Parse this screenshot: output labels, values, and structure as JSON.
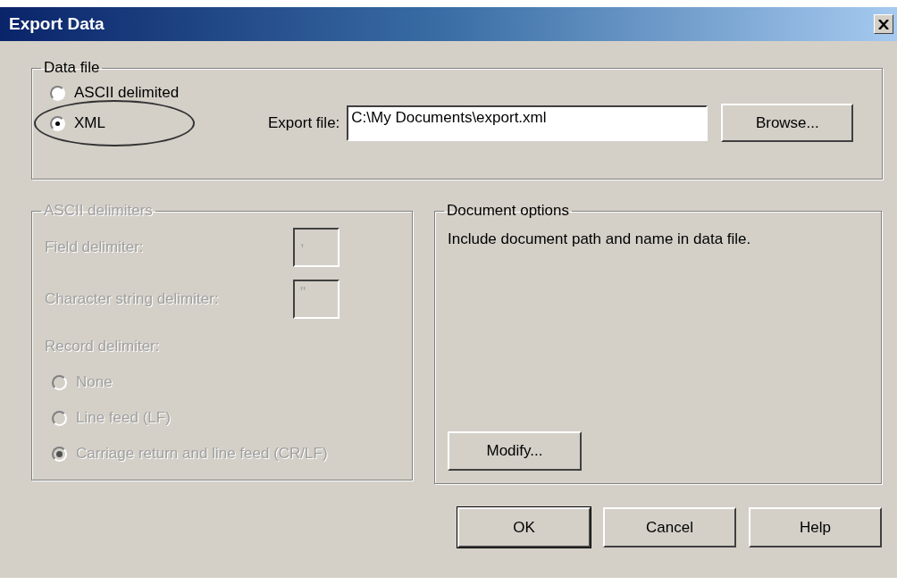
{
  "window": {
    "title": "Export Data"
  },
  "data_file": {
    "legend": "Data file",
    "formats": [
      {
        "label": "ASCII delimited",
        "selected": false,
        "circled": false
      },
      {
        "label": "XML",
        "selected": true,
        "circled": true
      }
    ],
    "export_file": {
      "label": "Export file:",
      "value": "C:\\My Documents\\export.xml"
    },
    "browse_button": "Browse..."
  },
  "ascii_delimiters": {
    "legend": "ASCII delimiters",
    "disabled": true,
    "fields": [
      {
        "label": "Field delimiter:",
        "value": ","
      },
      {
        "label": "Character string delimiter:",
        "value": "\""
      }
    ],
    "record_label": "Record delimiter:",
    "record_options": [
      {
        "label": "None",
        "selected": false
      },
      {
        "label": "Line feed (LF)",
        "selected": false
      },
      {
        "label": "Carriage return and line feed (CR/LF)",
        "selected": true
      }
    ]
  },
  "document_options": {
    "legend": "Document options",
    "text": "Include document path and name in data file.",
    "modify_button": "Modify..."
  },
  "buttons": [
    {
      "label": "OK",
      "default": true
    },
    {
      "label": "Cancel",
      "default": false
    },
    {
      "label": "Help",
      "default": false
    }
  ]
}
